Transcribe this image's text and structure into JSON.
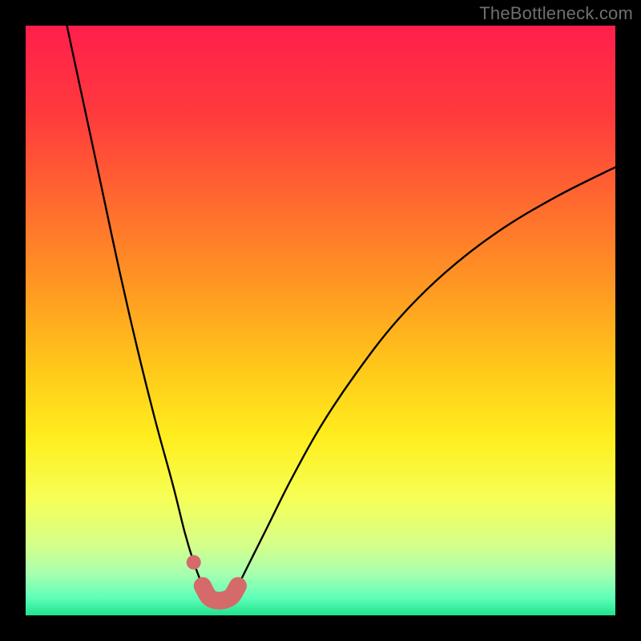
{
  "watermark": "TheBottleneck.com",
  "colors": {
    "gradient_stops": [
      {
        "offset": 0.0,
        "color": "#ff1f4b"
      },
      {
        "offset": 0.15,
        "color": "#ff3a3d"
      },
      {
        "offset": 0.3,
        "color": "#ff6a2f"
      },
      {
        "offset": 0.45,
        "color": "#ff9a22"
      },
      {
        "offset": 0.58,
        "color": "#ffc81a"
      },
      {
        "offset": 0.7,
        "color": "#ffee1f"
      },
      {
        "offset": 0.8,
        "color": "#f6ff55"
      },
      {
        "offset": 0.88,
        "color": "#d6ff8a"
      },
      {
        "offset": 0.93,
        "color": "#a6ffb0"
      },
      {
        "offset": 0.97,
        "color": "#5fffb8"
      },
      {
        "offset": 1.0,
        "color": "#21e28e"
      }
    ],
    "curve": "#000000",
    "highlight": "#d46a6a",
    "highlight_dot": "#d46a6a",
    "frame_bg": "#000000"
  },
  "chart_data": {
    "type": "line",
    "title": "",
    "xlabel": "",
    "ylabel": "",
    "xlim": [
      0,
      100
    ],
    "ylim": [
      0,
      100
    ],
    "x_at_minimum": 32,
    "series": [
      {
        "name": "left-branch",
        "x": [
          7,
          10,
          13,
          16,
          19,
          22,
          25,
          27,
          28.5,
          30
        ],
        "y": [
          100,
          86,
          72,
          58,
          45,
          33,
          22,
          14,
          9,
          5
        ]
      },
      {
        "name": "right-branch",
        "x": [
          36,
          38,
          41,
          45,
          50,
          56,
          63,
          71,
          80,
          90,
          100
        ],
        "y": [
          5,
          9,
          15,
          23,
          32,
          41,
          50,
          58,
          65,
          71,
          76
        ]
      },
      {
        "name": "floor",
        "x": [
          30,
          31,
          32,
          33,
          34,
          35,
          36
        ],
        "y": [
          5,
          3.2,
          2.6,
          2.5,
          2.7,
          3.3,
          5
        ]
      }
    ],
    "highlight": {
      "dot": {
        "x": 28.5,
        "y": 9
      },
      "segment_x": [
        30,
        31,
        32,
        33,
        34,
        35,
        36
      ],
      "segment_y": [
        5,
        3.2,
        2.6,
        2.5,
        2.7,
        3.3,
        5
      ]
    }
  }
}
